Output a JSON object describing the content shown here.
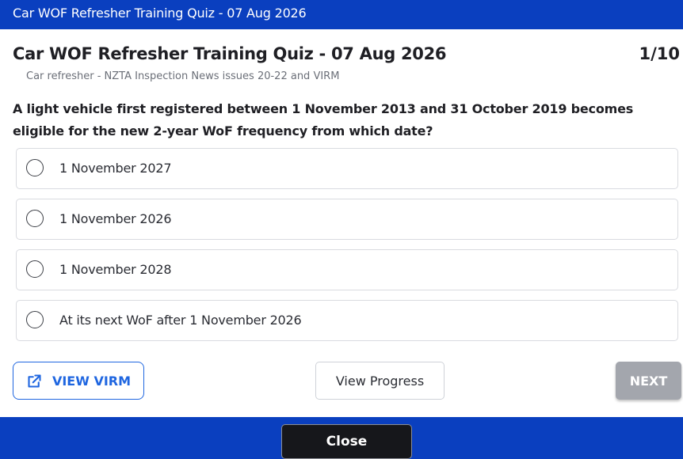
{
  "window": {
    "title": "Car WOF Refresher Training Quiz - 07 Aug 2026"
  },
  "quiz": {
    "title": "Car WOF Refresher Training Quiz - 07 Aug 2026",
    "counter": "1/10",
    "subtitle": "Car refresher - NZTA Inspection News issues 20-22 and VIRM",
    "question": "A light vehicle first registered between 1 November 2013 and 31 October 2019 becomes eligible for the new 2-year WoF frequency from which date?",
    "options": [
      {
        "label": "1 November 2027",
        "selected": false
      },
      {
        "label": "1 November 2026",
        "selected": false
      },
      {
        "label": "1 November 2028",
        "selected": false
      },
      {
        "label": "At its next WoF after 1 November 2026",
        "selected": false
      }
    ]
  },
  "actions": {
    "view_virm_label": "VIEW VIRM",
    "view_virm_icon": "external-link-icon",
    "view_progress_label": "View Progress",
    "next_label": "NEXT",
    "next_enabled": false
  },
  "footer": {
    "close_label": "Close"
  },
  "colors": {
    "brand_blue": "#0a3fbf",
    "accent_blue": "#1f66e0",
    "disabled_gray": "#a3a6ad",
    "close_dark": "#16171b"
  }
}
